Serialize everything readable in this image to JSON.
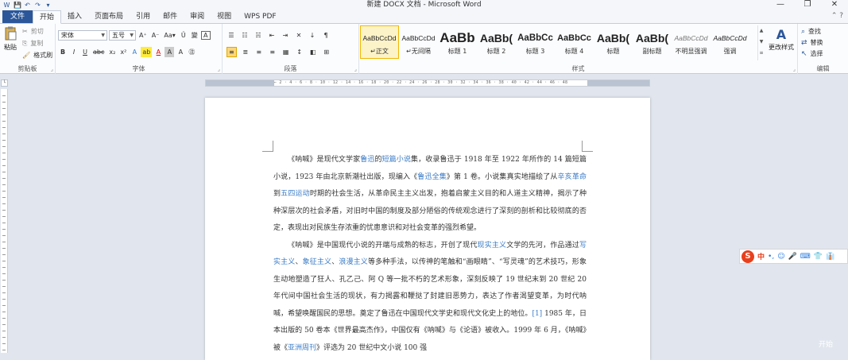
{
  "window": {
    "title": "新建 DOCX 文档 - Microsoft Word",
    "quick_access": [
      "W",
      "💾",
      "↶",
      "↷",
      "▾"
    ],
    "controls": [
      "—",
      "❐",
      "✕"
    ]
  },
  "tabs": [
    {
      "label": "文件"
    },
    {
      "label": "开始"
    },
    {
      "label": "插入"
    },
    {
      "label": "页面布局"
    },
    {
      "label": "引用"
    },
    {
      "label": "邮件"
    },
    {
      "label": "审阅"
    },
    {
      "label": "视图"
    },
    {
      "label": "WPS PDF"
    }
  ],
  "ribbon_controls": "⌃ ?",
  "clipboard": {
    "label": "剪贴板",
    "paste": "粘贴",
    "cut": "剪切",
    "copy": "复制",
    "format_painter": "格式刷"
  },
  "font": {
    "label": "字体",
    "family": "宋体",
    "size": "五号",
    "row1": [
      "A⁺",
      "A⁻",
      "Aa▾",
      "Ǔ",
      "變",
      "A"
    ],
    "row2": [
      "B",
      "I",
      "U",
      "abc",
      "x₂",
      "x²",
      "A",
      "ab",
      "A",
      "A",
      "A",
      "㊟"
    ]
  },
  "paragraph": {
    "label": "段落",
    "row1": [
      "☰",
      "☷",
      "☵",
      "⇤",
      "⇥",
      "✕",
      "↓",
      "¶"
    ],
    "row2": [
      "≡",
      "≣",
      "≡",
      "≡",
      "▦",
      "↕",
      "◧",
      "⊞"
    ]
  },
  "styles": {
    "label": "样式",
    "items": [
      {
        "preview": "AaBbCcDd",
        "name": "↵正文"
      },
      {
        "preview": "AaBbCcDd",
        "name": "↵无间隔"
      },
      {
        "preview": "AaBb",
        "name": "标题 1"
      },
      {
        "preview": "AaBb(",
        "name": "标题 2"
      },
      {
        "preview": "AaBbCc",
        "name": "标题 3"
      },
      {
        "preview": "AaBbCc",
        "name": "标题 4"
      },
      {
        "preview": "AaBb(",
        "name": "标题"
      },
      {
        "preview": "AaBb(",
        "name": "副标题"
      },
      {
        "preview": "AaBbCcDd",
        "name": "不明显强调"
      },
      {
        "preview": "AaBbCcDd",
        "name": "强调"
      }
    ],
    "change_styles": "更改样式"
  },
  "editing": {
    "label": "编辑",
    "find": "查找",
    "replace": "替换",
    "select": "选择"
  },
  "ruler": {
    "ticks": "⌐ 2 · 4 · 6 · 8 · 10 · 12 · 14 · 16 · 18 · 20 · 22 · 24 · 26 · 28 · 30 · 32 · 34 · 36 · 38 · 40 · 42 · 44 · 46 · 48"
  },
  "document": {
    "paragraphs": [
      [
        {
          "t": "《呐喊》是现代文学家"
        },
        {
          "t": "鲁迅",
          "link": true
        },
        {
          "t": "的"
        },
        {
          "t": "短篇小说",
          "link": true
        },
        {
          "t": "集，收录鲁迅于 1918 年至 1922 年所作的 14 篇短篇小说，1923 年由北京新潮社出版，现编入《"
        },
        {
          "t": "鲁迅全集",
          "link": true
        },
        {
          "t": "》第 1 卷。小说集真实地描绘了从"
        },
        {
          "t": "辛亥革命",
          "link": true
        },
        {
          "t": "到"
        },
        {
          "t": "五四运动",
          "link": true
        },
        {
          "t": "时期的社会生活，从革命民主主义出发，抱着启蒙主义目的和人道主义精神，揭示了种种深层次的社会矛盾，对旧时中国的制度及部分陋俗的传统观念进行了深刻的剖析和比较彻底的否定，表现出对民族生存浓重的忧患意识和对社会变革的强烈希望。"
        }
      ],
      [
        {
          "t": "《呐喊》是中国现代小说的开端与成熟的标志，开创了现代"
        },
        {
          "t": "现实主义",
          "link": true
        },
        {
          "t": "文学的先河，作品通过"
        },
        {
          "t": "写实主义",
          "link": true
        },
        {
          "t": "、"
        },
        {
          "t": "象征主义",
          "link": true
        },
        {
          "t": "、"
        },
        {
          "t": "浪漫主义",
          "link": true
        },
        {
          "t": "等多种手法，以传神的笔触和“画眼睛”、“写灵魂”的艺术技巧，形象生动地塑造了狂人、孔乙己、阿 Q 等一批不朽的艺术形象，深刻反映了 19 世纪末到 20 世纪 20 年代间中国社会生活的现状，有力揭露和鞭挞了封建旧恶势力，表达了作者渴望变革，为时代呐喊，希望唤醒国民的思想。奠定了鲁迅在中国现代文学史和现代文化史上的地位。"
        },
        {
          "t": "[1]",
          "link": true
        },
        {
          "t": " 1985 年，日本出版的 50 卷本《世界最高杰作》，中国仅有《呐喊》与《论语》被收入。1999 年 6 月，《呐喊》被《"
        },
        {
          "t": "亚洲周刊",
          "link": true
        },
        {
          "t": "》评选为 20 世纪中文小说 100 强"
        }
      ]
    ]
  },
  "ime": {
    "logo": "S",
    "items": [
      "中",
      "•,",
      "☺",
      "🎤",
      "⌨",
      "👕",
      "👔"
    ]
  },
  "watermark": "开始"
}
